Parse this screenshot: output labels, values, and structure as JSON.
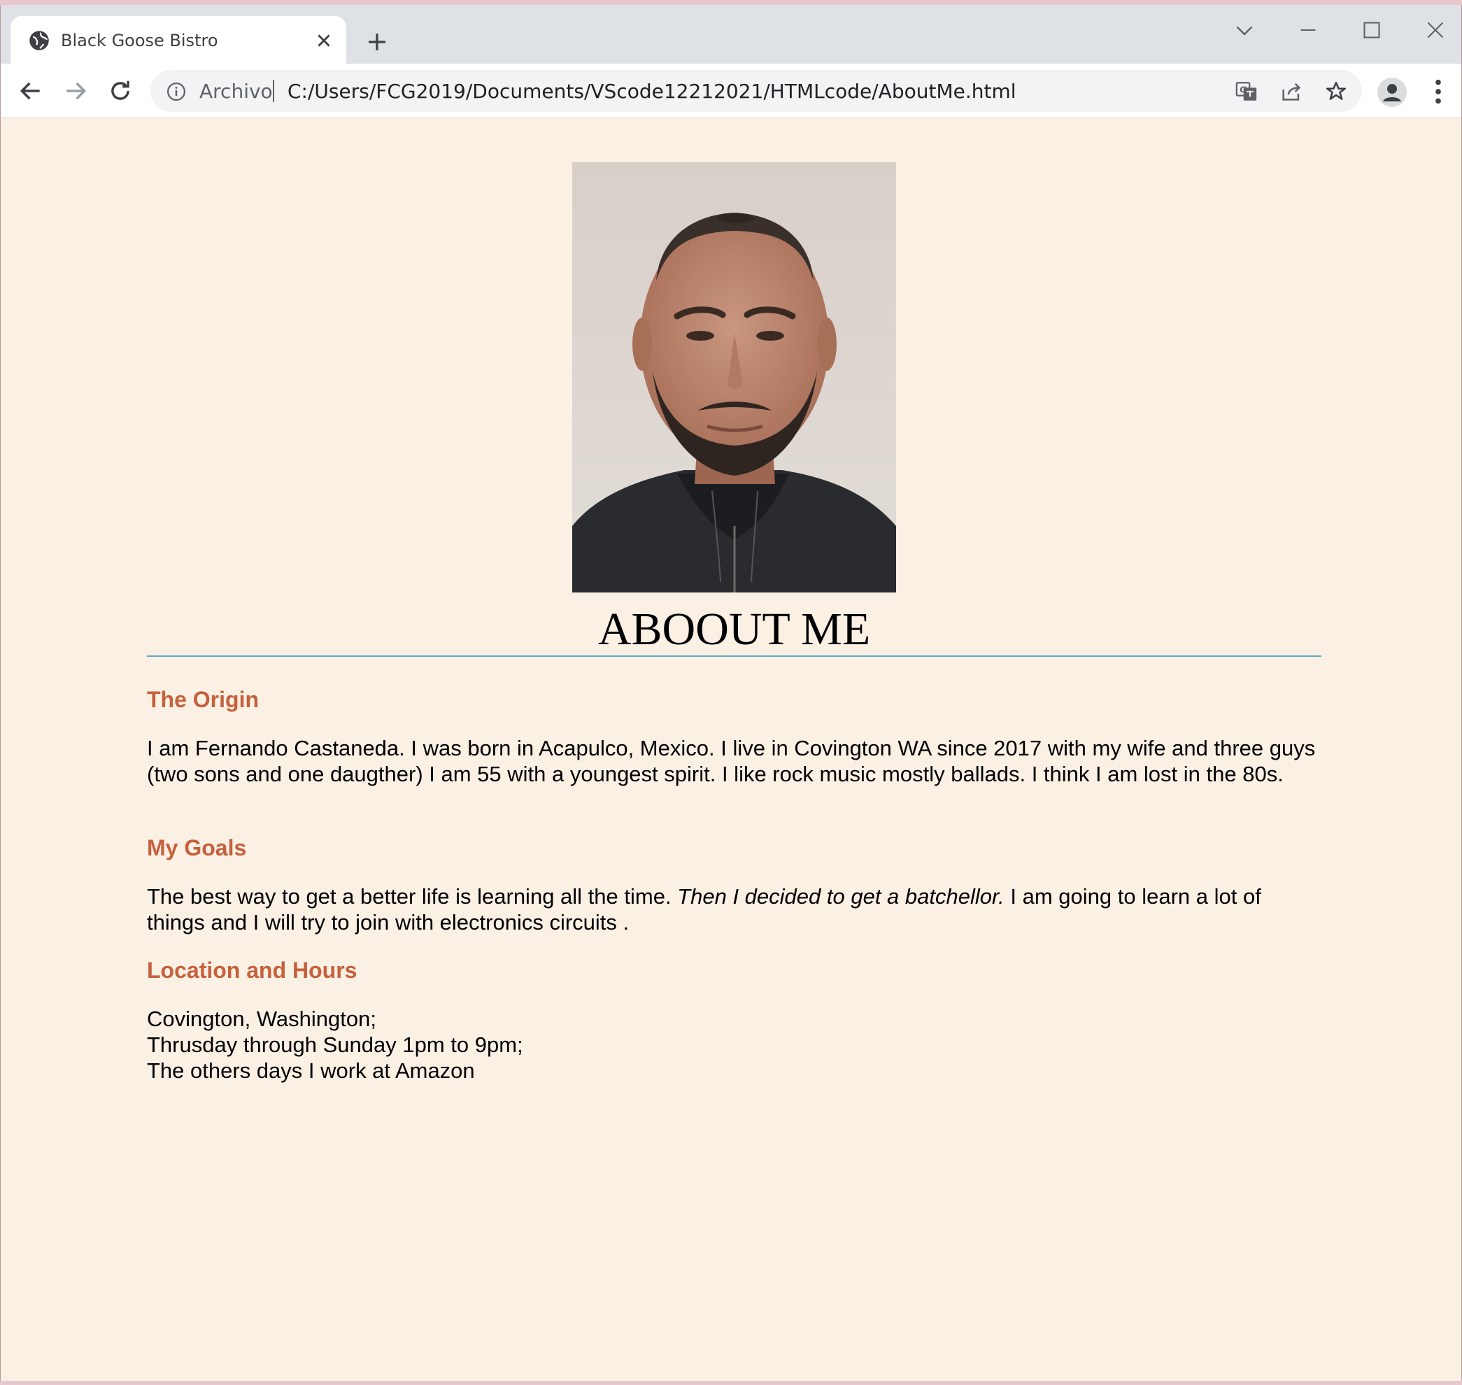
{
  "browser": {
    "tab": {
      "title": "Black Goose Bistro"
    },
    "address_bar": {
      "scheme_label": "Archivo",
      "url": "C:/Users/FCG2019/Documents/VScode12212021/HTMLcode/AboutMe.html"
    },
    "icons": {
      "favicon": "globe-icon",
      "close_tab": "close-icon",
      "new_tab": "plus-icon",
      "back": "arrow-left-icon",
      "forward": "arrow-right-icon",
      "reload": "reload-icon",
      "info": "info-icon",
      "translate": "translate-icon",
      "share": "share-icon",
      "bookmark": "star-icon",
      "profile": "avatar-icon",
      "menu": "kebab-menu-icon"
    }
  },
  "page": {
    "photo": {
      "description_icon": "portrait-photo"
    },
    "heading": "ABOOUT ME",
    "sections": {
      "origin": {
        "title": "The Origin",
        "text": "I am Fernando Castaneda. I was born in Acapulco, Mexico. I live in Covington WA since 2017 with my wife and three guys (two sons and one daugther) I am 55 with a youngest spirit. I like rock music mostly ballads. I think I am lost in the 80s."
      },
      "goals": {
        "title": "My Goals",
        "text_before": "The best way to get a better life is learning all the time. ",
        "text_emphasis": "Then I decided to get a batchellor.",
        "text_after": " I am going to learn a lot of things and I will try to join with electronics circuits ."
      },
      "location": {
        "title": "Location and Hours",
        "lines": [
          "Covington, Washington;",
          "Thrusday through Sunday 1pm to 9pm;",
          "The others days I work at Amazon"
        ]
      }
    },
    "colors": {
      "background": "#faf0e4",
      "section_heading": "#c6603c",
      "rule": "#5fa8c8"
    }
  }
}
